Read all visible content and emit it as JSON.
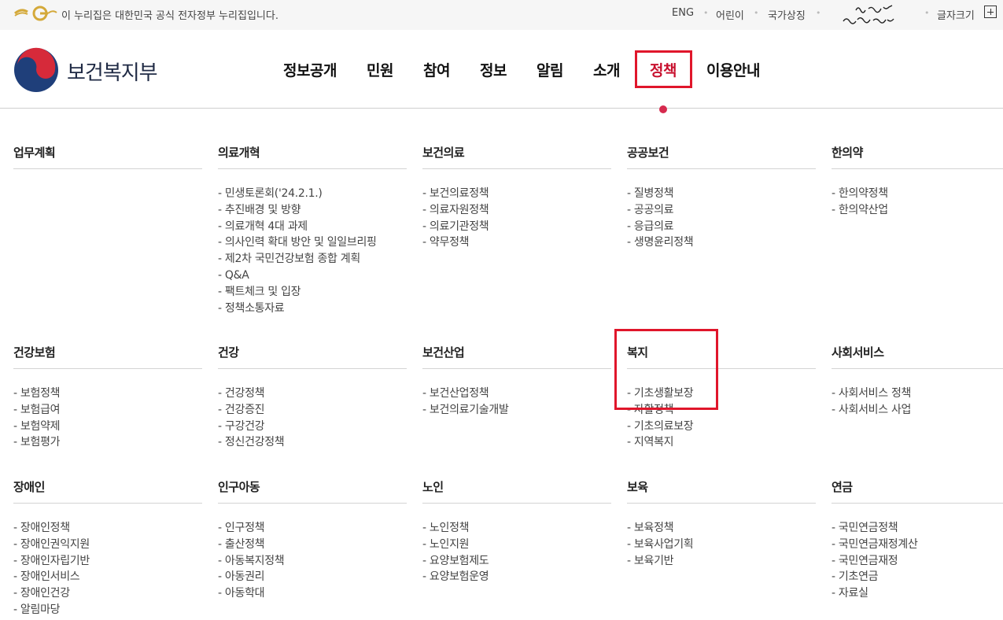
{
  "gov_banner": {
    "text": "이 누리집은 대한민국 공식 전자정부 누리집입니다.",
    "links": [
      "ENG",
      "어린이",
      "국가상징"
    ],
    "font_size_label": "글자크기"
  },
  "header": {
    "site_name": "보건복지부",
    "nav": [
      "정보공개",
      "민원",
      "참여",
      "정보",
      "알림",
      "소개",
      "정책",
      "이용안내"
    ],
    "active_nav": "정책"
  },
  "menu": [
    {
      "title": "업무계획",
      "items": []
    },
    {
      "title": "의료개혁",
      "items": [
        "민생토론회('24.2.1.)",
        "추진배경 및 방향",
        "의료개혁 4대 과제",
        "의사인력 확대 방안 및 일일브리핑",
        "제2차 국민건강보험 종합 계획",
        "Q&A",
        "팩트체크 및 입장",
        "정책소통자료"
      ]
    },
    {
      "title": "보건의료",
      "items": [
        "보건의료정책",
        "의료자원정책",
        "의료기관정책",
        "약무정책"
      ]
    },
    {
      "title": "공공보건",
      "items": [
        "질병정책",
        "공공의료",
        "응급의료",
        "생명윤리정책"
      ]
    },
    {
      "title": "한의약",
      "items": [
        "한의약정책",
        "한의약산업"
      ]
    },
    {
      "title": "건강보험",
      "items": [
        "보험정책",
        "보험급여",
        "보험약제",
        "보험평가"
      ]
    },
    {
      "title": "건강",
      "items": [
        "건강정책",
        "건강증진",
        "구강건강",
        "정신건강정책"
      ]
    },
    {
      "title": "보건산업",
      "items": [
        "보건산업정책",
        "보건의료기술개발"
      ]
    },
    {
      "title": "복지",
      "items": [
        "기초생활보장",
        "자활정책",
        "기초의료보장",
        "지역복지"
      ]
    },
    {
      "title": "사회서비스",
      "items": [
        "사회서비스 정책",
        "사회서비스 사업"
      ]
    },
    {
      "title": "장애인",
      "items": [
        "장애인정책",
        "장애인권익지원",
        "장애인자립기반",
        "장애인서비스",
        "장애인건강",
        "알림마당"
      ]
    },
    {
      "title": "인구아동",
      "items": [
        "인구정책",
        "출산정책",
        "아동복지정책",
        "아동권리",
        "아동학대"
      ]
    },
    {
      "title": "노인",
      "items": [
        "노인정책",
        "노인지원",
        "요양보험제도",
        "요양보험운영"
      ]
    },
    {
      "title": "보육",
      "items": [
        "보육정책",
        "보육사업기획",
        "보육기반"
      ]
    },
    {
      "title": "연금",
      "items": [
        "국민연금정책",
        "국민연금재정계산",
        "국민연금재정",
        "기초연금",
        "자료실"
      ]
    }
  ],
  "colors": {
    "active": "#c8102e",
    "highlight_border": "#e0162b",
    "indicator_dot": "#d62a4e"
  }
}
